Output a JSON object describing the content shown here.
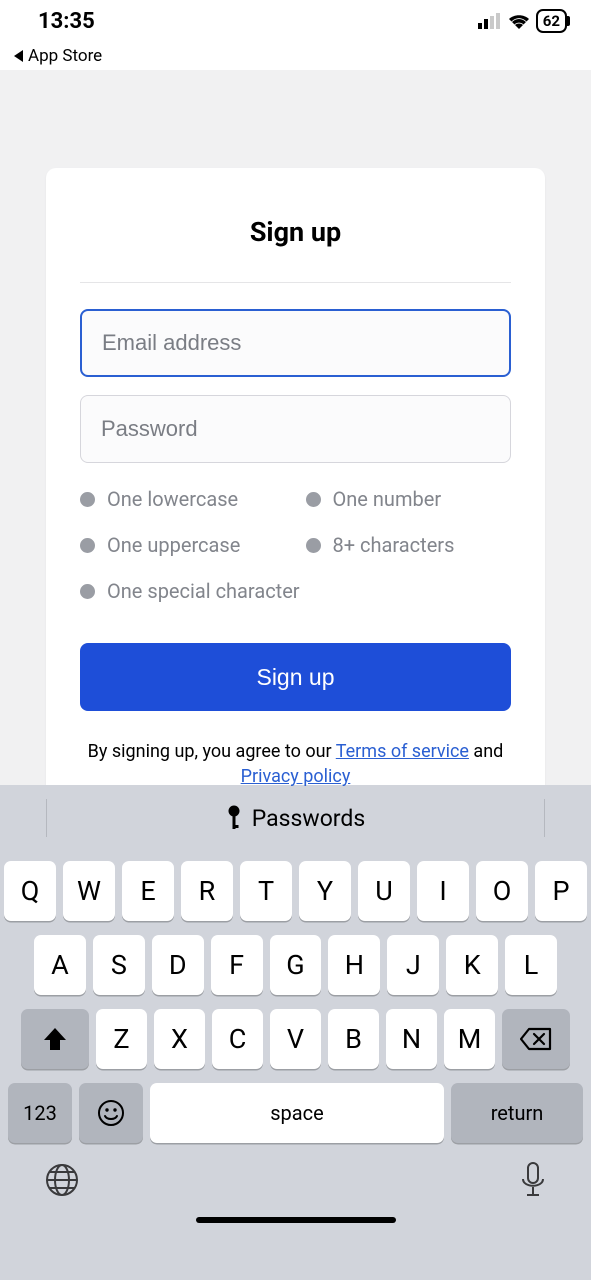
{
  "status": {
    "time": "13:35",
    "back_label": "App Store",
    "battery": "62"
  },
  "signup": {
    "title": "Sign up",
    "email_placeholder": "Email address",
    "password_placeholder": "Password",
    "rules": {
      "lowercase": "One lowercase",
      "number": "One number",
      "uppercase": "One uppercase",
      "chars": "8+ characters",
      "special": "One special character"
    },
    "button": "Sign up",
    "agree_prefix": "By signing up, you agree to our ",
    "terms": "Terms of service",
    "agree_mid": " and ",
    "privacy": "Privacy policy"
  },
  "keyboard": {
    "passwords_label": "Passwords",
    "row1": [
      "Q",
      "W",
      "E",
      "R",
      "T",
      "Y",
      "U",
      "I",
      "O",
      "P"
    ],
    "row2": [
      "A",
      "S",
      "D",
      "F",
      "G",
      "H",
      "J",
      "K",
      "L"
    ],
    "row3": [
      "Z",
      "X",
      "C",
      "V",
      "B",
      "N",
      "M"
    ],
    "num": "123",
    "space": "space",
    "return": "return"
  }
}
